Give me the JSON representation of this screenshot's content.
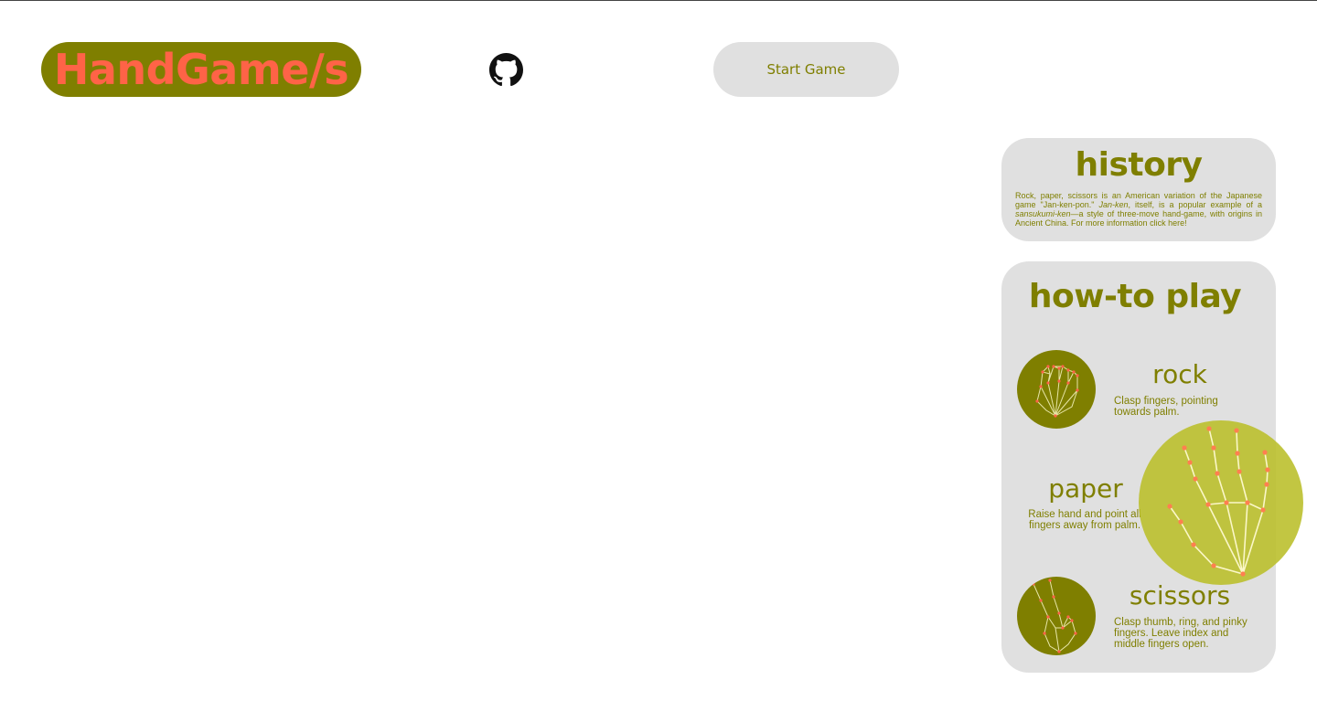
{
  "header": {
    "logo_text": "HandGame/s",
    "github_icon": "github-icon",
    "start_label": "Start Game"
  },
  "history": {
    "title": "history",
    "text_1": "Rock, paper, scissors is an American variation of the Japanese game \"Jan-ken-pon.\" ",
    "text_em1": "Jan-ken",
    "text_2": ", itself, is a popular example of a ",
    "text_em2": "sansukumi-ken",
    "text_3": "—a style of three-move hand-game, with origins in Ancient China. For more information ",
    "link": "click here!"
  },
  "howto": {
    "title": "how-to play",
    "gestures": [
      {
        "name": "rock",
        "description": "Clasp fingers, pointing towards palm.",
        "icon": "rock-hand-icon"
      },
      {
        "name": "paper",
        "description": "Raise hand and point all fingers away from palm.",
        "icon": "paper-hand-icon"
      },
      {
        "name": "scissors",
        "description": "Clasp thumb, ring, and pinky fingers. Leave index and middle fingers open.",
        "icon": "scissors-hand-icon"
      }
    ]
  },
  "colors": {
    "olive": "#7f7f00",
    "coral": "#ff6347",
    "card_bg": "#e0e0e0",
    "paper_highlight": "#b9be28"
  }
}
